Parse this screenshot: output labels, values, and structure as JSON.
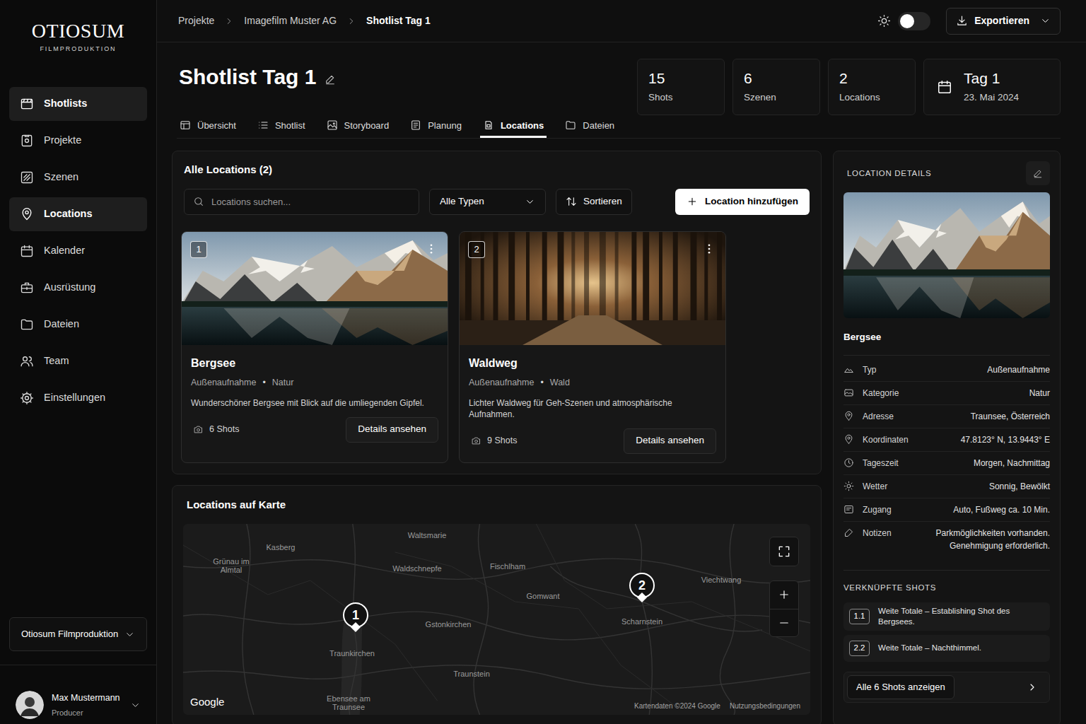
{
  "brand": {
    "name": "OTIOSUM",
    "tagline": "FILMPRODUKTION"
  },
  "sidebar": {
    "items": [
      {
        "label": "Shotlists",
        "selected": true
      },
      {
        "label": "Projekte",
        "selected": false
      },
      {
        "label": "Szenen",
        "selected": false
      },
      {
        "label": "Locations",
        "selected": true
      },
      {
        "label": "Kalender",
        "selected": false
      },
      {
        "label": "Ausrüstung",
        "selected": false
      },
      {
        "label": "Dateien",
        "selected": false
      },
      {
        "label": "Team",
        "selected": false
      },
      {
        "label": "Einstellungen",
        "selected": false
      }
    ],
    "workspace": "Otiosum Filmproduktion",
    "user": {
      "name": "Max Mustermann",
      "role": "Producer"
    }
  },
  "breadcrumb": [
    {
      "label": "Projekte",
      "current": false
    },
    {
      "label": "Imagefilm Muster AG",
      "current": false
    },
    {
      "label": "Shotlist Tag 1",
      "current": true
    }
  ],
  "theme_toggle": {
    "on": false
  },
  "export_button": "Exportieren",
  "page_title": "Shotlist Tag 1",
  "stats": [
    {
      "value": "15",
      "label": "Shots"
    },
    {
      "value": "6",
      "label": "Szenen"
    },
    {
      "value": "2",
      "label": "Locations"
    }
  ],
  "day": {
    "title": "Tag 1",
    "date": "23. Mai 2024"
  },
  "tabs": [
    {
      "label": "Übersicht",
      "selected": false
    },
    {
      "label": "Shotlist",
      "selected": false
    },
    {
      "label": "Storyboard",
      "selected": false
    },
    {
      "label": "Planung",
      "selected": false
    },
    {
      "label": "Locations",
      "selected": true
    },
    {
      "label": "Dateien",
      "selected": false
    }
  ],
  "locations": {
    "title": "Alle Locations (2)",
    "search_placeholder": "Locations suchen...",
    "type_filter": "Alle Typen",
    "sort_button": "Sortieren",
    "add_button": "Location hinzufügen",
    "cards": [
      {
        "number": "1",
        "name": "Bergsee",
        "type": "Außenaufnahme",
        "separator": "•",
        "category": "Natur",
        "description": "Wunderschöner Bergsee mit Blick auf die umliegenden Gipfel.",
        "shots": "6 Shots",
        "details_button": "Details ansehen",
        "kind": "lake"
      },
      {
        "number": "2",
        "name": "Waldweg",
        "type": "Außenaufnahme",
        "separator": "•",
        "category": "Wald",
        "description": "Lichter Waldweg für Geh-Szenen und atmosphärische Aufnahmen.",
        "shots": "9 Shots",
        "details_button": "Details ansehen",
        "kind": "forest"
      }
    ]
  },
  "map": {
    "title": "Locations auf Karte",
    "labels": [
      "Waltsmarie",
      "Kasberg",
      "Grünau im Almtal",
      "Waldschnepfe",
      "Fischlham",
      "Gomwant",
      "Viechtwang",
      "Gstonkirchen",
      "Scharnstein",
      "Traunkirchen",
      "Traunstein",
      "Ebensee am Traunsee"
    ],
    "pins": [
      {
        "number": "1"
      },
      {
        "number": "2"
      }
    ],
    "logo": "Google",
    "attribution": "Kartendaten ©2024 Google",
    "terms": "Nutzungsbedingungen"
  },
  "details": {
    "title": "LOCATION DETAILS",
    "name": "Bergsee",
    "rows": [
      {
        "label": "Typ",
        "value": "Außenaufnahme"
      },
      {
        "label": "Kategorie",
        "value": "Natur"
      },
      {
        "label": "Adresse",
        "value": "Traunsee, Österreich"
      },
      {
        "label": "Koordinaten",
        "value": "47.8123° N, 13.9443° E"
      },
      {
        "label": "Tageszeit",
        "value": "Morgen, Nachmittag"
      },
      {
        "label": "Wetter",
        "value": "Sonnig, Bewölkt"
      },
      {
        "label": "Zugang",
        "value": "Auto, Fußweg ca. 10 Min."
      },
      {
        "label": "Notizen",
        "value": "Parkmöglichkeiten vorhanden. Genehmigung erforderlich."
      }
    ],
    "linked_title": "VERKNÜPFTE SHOTS",
    "linked": [
      {
        "id": "1.1",
        "text": "Weite Totale – Establishing Shot des Bergsees."
      },
      {
        "id": "2.2",
        "text": "Weite Totale – Nachthimmel."
      }
    ],
    "all_button": "Alle 6 Shots anzeigen"
  }
}
